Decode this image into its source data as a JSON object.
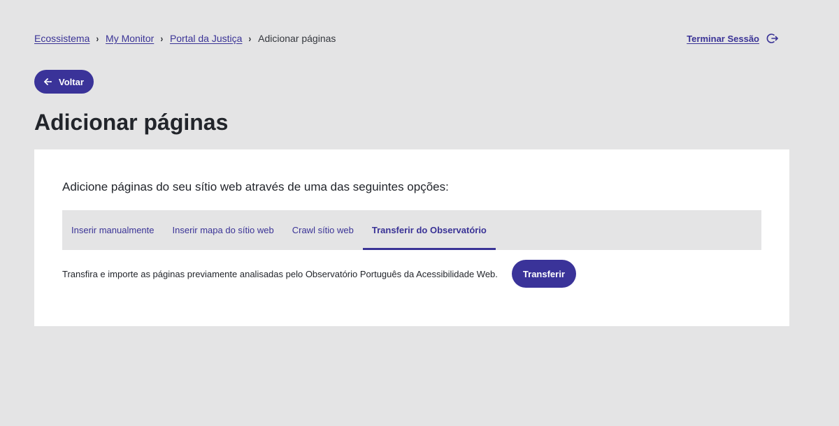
{
  "breadcrumb": {
    "items": [
      {
        "label": "Ecossistema"
      },
      {
        "label": "My Monitor"
      },
      {
        "label": "Portal da Justiça"
      }
    ],
    "current": "Adicionar páginas"
  },
  "header": {
    "logout_label": "Terminar Sessão",
    "logout_icon": "logout-icon"
  },
  "back_button": {
    "label": "Voltar",
    "icon": "arrow-left-icon"
  },
  "page_title": "Adicionar páginas",
  "card": {
    "intro": "Adicione páginas do seu sítio web através de uma das seguintes opções:",
    "tabs": [
      {
        "label": "Inserir manualmente",
        "active": false
      },
      {
        "label": "Inserir mapa do sítio web",
        "active": false
      },
      {
        "label": "Crawl sítio web",
        "active": false
      },
      {
        "label": "Transferir do Observatório",
        "active": true
      }
    ],
    "panel": {
      "description": "Transfira e importe as páginas previamente analisadas pelo Observatório Português da Acessibilidade Web.",
      "button_label": "Transferir"
    }
  },
  "colors": {
    "background": "#e4e4e5",
    "accent": "#3a3399",
    "text": "#22252b",
    "card": "#ffffff"
  }
}
